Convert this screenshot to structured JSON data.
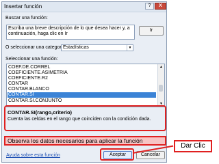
{
  "dialog": {
    "title": "Insertar función",
    "help_btn": "?",
    "close_btn": "X",
    "search_label": "Buscar una función:",
    "search_text": "Escriba una breve descripción de lo que desea hacer y, a continuación, haga clic en Ir",
    "ir_btn": "Ir",
    "category_label": "O seleccionar una categoría:",
    "category_value": "Estadísticas",
    "function_list_label": "Seleccionar una función:",
    "functions": [
      "COEF.DE.CORREL",
      "COEFICIENTE.ASIMETRIA",
      "COEFICIENTE.R2",
      "CONTAR",
      "CONTAR.BLANCO",
      "CONTAR.SI",
      "CONTAR.SI.CONJUNTO"
    ],
    "selected_function": "CONTAR.SI",
    "signature": "CONTAR.SI(rango,criterio)",
    "description": "Cuenta las celdas en el rango que coinciden con la condición dada.",
    "help_link": "Ayuda sobre esta función",
    "accept_btn": "Aceptar",
    "cancel_btn": "Cancelar"
  },
  "annotations": {
    "banner": "Observa los datos necesarios para aplicar la función",
    "callout": "Dar Clic",
    "highlight_color": "#e02020"
  },
  "colors": {
    "selection": "#3b83d6",
    "dialog_bg": "#e9eef5",
    "close_red": "#c94a3c"
  }
}
